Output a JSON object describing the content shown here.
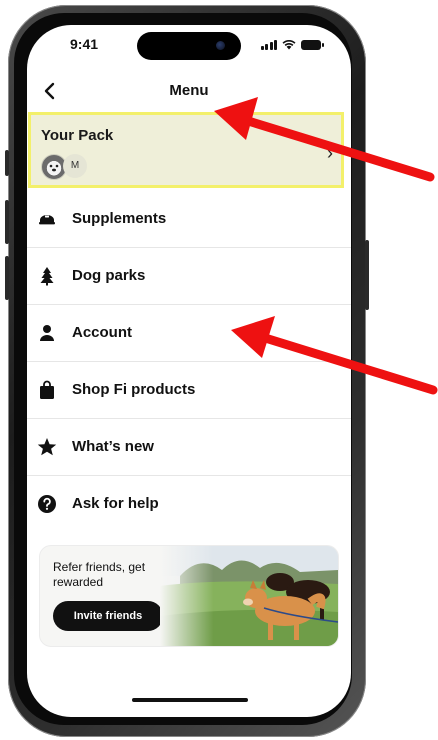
{
  "status_bar": {
    "time": "9:41"
  },
  "nav": {
    "title": "Menu"
  },
  "pack": {
    "title": "Your Pack",
    "member_initial": "M",
    "chevron": "›"
  },
  "menu": {
    "items": [
      {
        "label": "Supplements",
        "icon": "supplements-icon"
      },
      {
        "label": "Dog parks",
        "icon": "tree-icon"
      },
      {
        "label": "Account",
        "icon": "person-icon"
      },
      {
        "label": "Shop Fi products",
        "icon": "shopping-bag-icon"
      },
      {
        "label": "What’s new",
        "icon": "star-icon"
      },
      {
        "label": "Ask for help",
        "icon": "help-icon"
      }
    ]
  },
  "referral": {
    "headline": "Refer friends, get rewarded",
    "button_label": "Invite friends"
  },
  "colors": {
    "highlight_bg": "#efefd9",
    "highlight_border": "#f3f06a",
    "annotation_arrow": "#ee1111",
    "button_bg": "#111111"
  }
}
